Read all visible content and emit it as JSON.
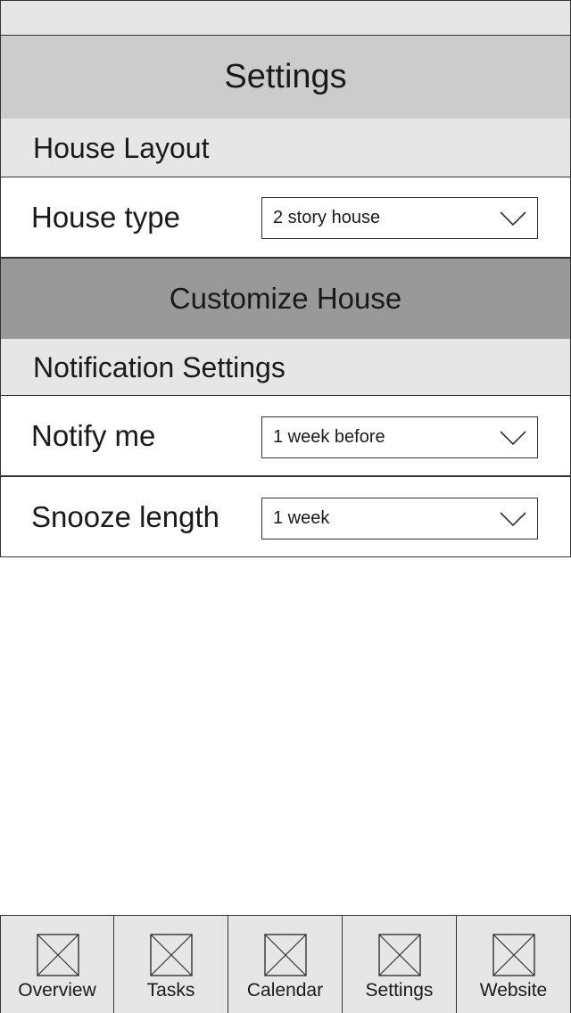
{
  "header": {
    "title": "Settings"
  },
  "house_layout": {
    "section_title": "House Layout",
    "house_type": {
      "label": "House type",
      "value": "2  story house"
    }
  },
  "customize": {
    "label": "Customize House"
  },
  "notifications": {
    "section_title": "Notification Settings",
    "notify_me": {
      "label": "Notify me",
      "value": "1 week before"
    },
    "snooze_length": {
      "label": "Snooze length",
      "value": "1 week"
    }
  },
  "tabs": [
    {
      "label": "Overview",
      "icon": "placeholder-image-icon"
    },
    {
      "label": "Tasks",
      "icon": "placeholder-image-icon"
    },
    {
      "label": "Calendar",
      "icon": "placeholder-image-icon"
    },
    {
      "label": "Settings",
      "icon": "placeholder-image-icon"
    },
    {
      "label": "Website",
      "icon": "placeholder-image-icon"
    }
  ],
  "colors": {
    "header_bg": "#cccccc",
    "section_bg": "#e6e6e6",
    "action_bg": "#999999",
    "border": "#333333"
  }
}
